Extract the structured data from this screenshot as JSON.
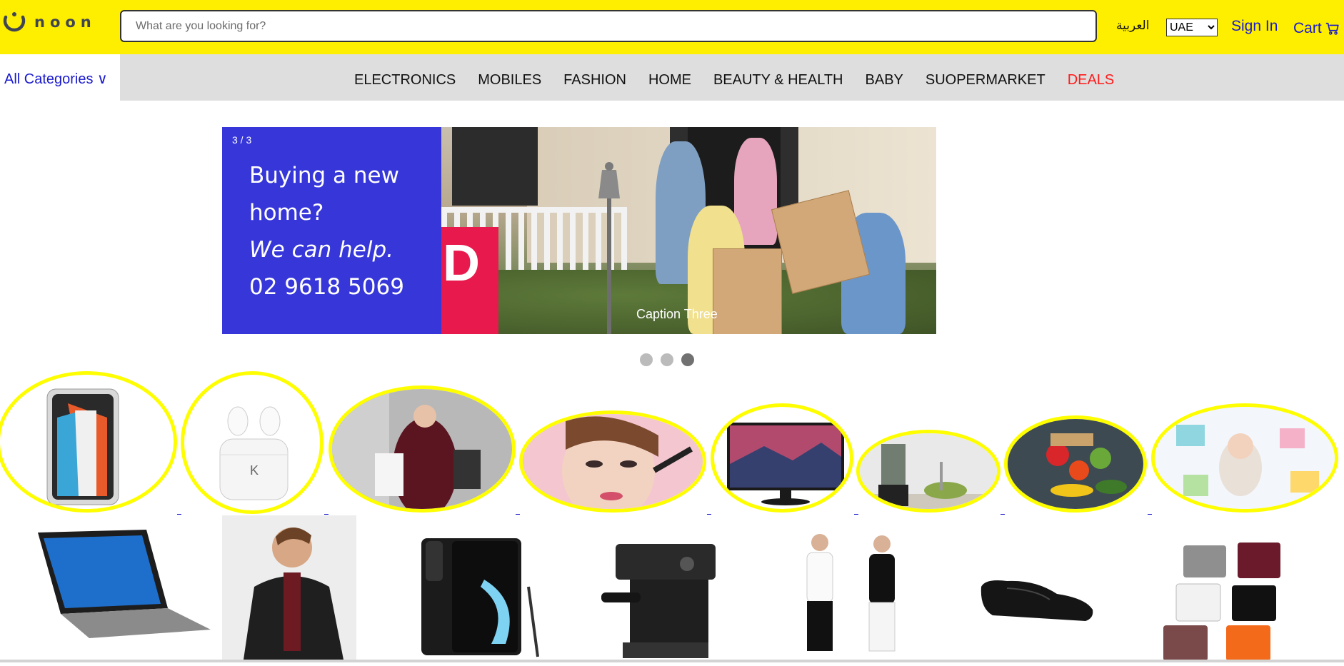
{
  "header": {
    "logo_text": "noon",
    "search_placeholder": "What are you looking for?",
    "language_link": "العربية",
    "country_selected": "UAE",
    "country_options": [
      "UAE"
    ],
    "signin_label": "Sign In",
    "cart_label": "Cart",
    "brand_color": "#feee00"
  },
  "nav": {
    "all_categories": "All Categories ∨",
    "items": [
      "ELECTRONICS",
      "MOBILES",
      "FASHION",
      "HOME",
      "BEAUTY & HEALTH",
      "BABY",
      "SUOPERMARKET"
    ],
    "deals_label": "DEALS",
    "deals_color": "#ff1a1a"
  },
  "slideshow": {
    "counter": "3 / 3",
    "promo_line1": "Buying a new",
    "promo_line2": "home?",
    "promo_line3": "We can help.",
    "promo_line4": "02 9618 5069",
    "sign_letter": "D",
    "caption": "Caption Three",
    "total_slides": 3,
    "active_slide": 3
  },
  "category_circles": [
    {
      "name": "smartphone",
      "icon": "iphone-icon"
    },
    {
      "name": "earbuds",
      "icon": "earbuds-icon"
    },
    {
      "name": "fashion",
      "icon": "shopping-bags-icon"
    },
    {
      "name": "beauty",
      "icon": "makeup-icon"
    },
    {
      "name": "monitor",
      "icon": "monitor-icon"
    },
    {
      "name": "kitchen",
      "icon": "blender-icon"
    },
    {
      "name": "groceries",
      "icon": "vegetables-icon"
    },
    {
      "name": "baby",
      "icon": "baby-icon"
    }
  ],
  "products": [
    {
      "name": "laptop",
      "icon": "laptop-icon"
    },
    {
      "name": "leather-jacket",
      "icon": "jacket-icon"
    },
    {
      "name": "galaxy-note",
      "icon": "phone-icon"
    },
    {
      "name": "espresso-machine",
      "icon": "coffee-machine-icon"
    },
    {
      "name": "tank-tops",
      "icon": "tank-top-icon"
    },
    {
      "name": "loafer",
      "icon": "shoe-icon"
    },
    {
      "name": "boxer-briefs",
      "icon": "underwear-icon"
    }
  ]
}
